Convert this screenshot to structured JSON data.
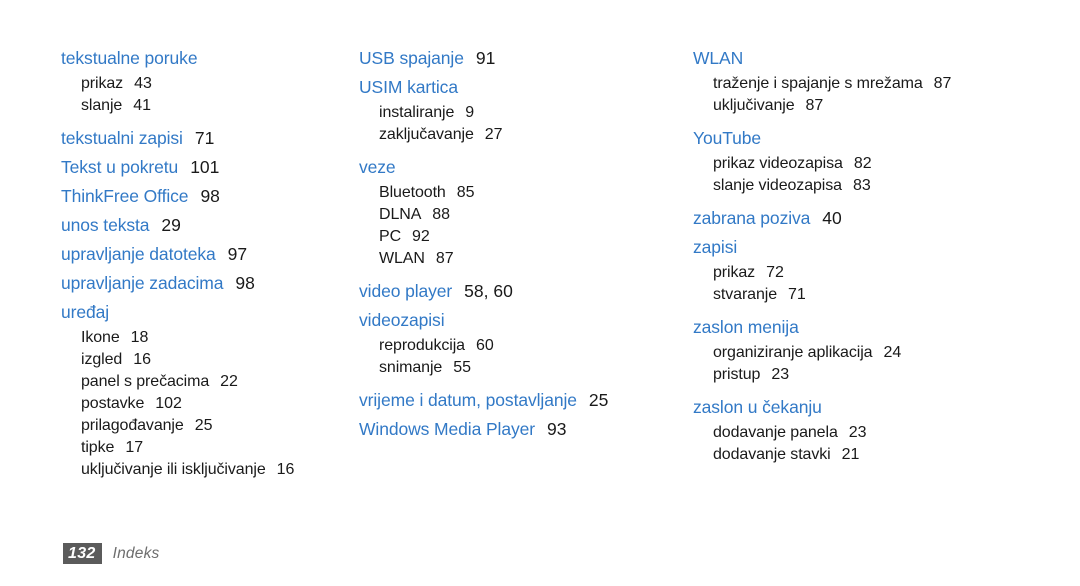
{
  "document": {
    "type": "index-page",
    "colors": {
      "heading_blue": "#3279c6",
      "body_black": "#1a1a1a",
      "footer_box_gray": "#5b5b5b",
      "footer_text_gray": "#6e6e6e",
      "background": "#ffffff"
    }
  },
  "columns": [
    {
      "id": "column-1",
      "groups": [
        {
          "heading": {
            "label": "tekstualne poruke",
            "page": ""
          },
          "subentries": [
            {
              "label": "prikaz",
              "page": "43"
            },
            {
              "label": "slanje",
              "page": "41"
            }
          ]
        },
        {
          "heading": {
            "label": "tekstualni zapisi",
            "page": "71"
          },
          "subentries": []
        },
        {
          "heading": {
            "label": "Tekst u pokretu",
            "page": "101"
          },
          "subentries": []
        },
        {
          "heading": {
            "label": "ThinkFree Office",
            "page": "98"
          },
          "subentries": []
        },
        {
          "heading": {
            "label": "unos teksta",
            "page": "29"
          },
          "subentries": []
        },
        {
          "heading": {
            "label": "upravljanje datoteka",
            "page": "97"
          },
          "subentries": []
        },
        {
          "heading": {
            "label": "upravljanje zadacima",
            "page": "98"
          },
          "subentries": []
        },
        {
          "heading": {
            "label": "uređaj",
            "page": ""
          },
          "subentries": [
            {
              "label": "Ikone",
              "page": "18"
            },
            {
              "label": "izgled",
              "page": "16"
            },
            {
              "label": "panel s prečacima",
              "page": "22"
            },
            {
              "label": "postavke",
              "page": "102"
            },
            {
              "label": "prilagođavanje",
              "page": "25"
            },
            {
              "label": "tipke",
              "page": "17"
            },
            {
              "label": "uključivanje ili isključivanje",
              "page": "16"
            }
          ]
        }
      ]
    },
    {
      "id": "column-2",
      "groups": [
        {
          "heading": {
            "label": "USB spajanje",
            "page": "91"
          },
          "subentries": []
        },
        {
          "heading": {
            "label": "USIM kartica",
            "page": ""
          },
          "subentries": [
            {
              "label": "instaliranje",
              "page": "9"
            },
            {
              "label": "zaključavanje",
              "page": "27"
            }
          ]
        },
        {
          "heading": {
            "label": "veze",
            "page": ""
          },
          "subentries": [
            {
              "label": "Bluetooth",
              "page": "85"
            },
            {
              "label": "DLNA",
              "page": "88"
            },
            {
              "label": "PC",
              "page": "92"
            },
            {
              "label": "WLAN",
              "page": "87"
            }
          ]
        },
        {
          "heading": {
            "label": "video player",
            "page": "58, 60"
          },
          "subentries": []
        },
        {
          "heading": {
            "label": "videozapisi",
            "page": ""
          },
          "subentries": [
            {
              "label": "reprodukcija",
              "page": "60"
            },
            {
              "label": "snimanje",
              "page": "55"
            }
          ]
        },
        {
          "heading": {
            "label": "vrijeme i datum, postavljanje",
            "page": "25"
          },
          "subentries": []
        },
        {
          "heading": {
            "label": "Windows Media Player",
            "page": "93"
          },
          "subentries": []
        }
      ]
    },
    {
      "id": "column-3",
      "groups": [
        {
          "heading": {
            "label": "WLAN",
            "page": ""
          },
          "subentries": [
            {
              "label": "traženje i spajanje s mrežama",
              "page": "87"
            },
            {
              "label": "uključivanje",
              "page": "87"
            }
          ]
        },
        {
          "heading": {
            "label": "YouTube",
            "page": ""
          },
          "subentries": [
            {
              "label": "prikaz videozapisa",
              "page": "82"
            },
            {
              "label": "slanje videozapisa",
              "page": "83"
            }
          ]
        },
        {
          "heading": {
            "label": "zabrana poziva",
            "page": "40"
          },
          "subentries": []
        },
        {
          "heading": {
            "label": "zapisi",
            "page": ""
          },
          "subentries": [
            {
              "label": "prikaz",
              "page": "72"
            },
            {
              "label": "stvaranje",
              "page": "71"
            }
          ]
        },
        {
          "heading": {
            "label": "zaslon menija",
            "page": ""
          },
          "subentries": [
            {
              "label": "organiziranje aplikacija",
              "page": "24"
            },
            {
              "label": "pristup",
              "page": "23"
            }
          ]
        },
        {
          "heading": {
            "label": "zaslon u čekanju",
            "page": ""
          },
          "subentries": [
            {
              "label": "dodavanje panela",
              "page": "23"
            },
            {
              "label": "dodavanje stavki",
              "page": "21"
            }
          ]
        }
      ]
    }
  ],
  "footer": {
    "page_number": "132",
    "section_title": "Indeks"
  }
}
